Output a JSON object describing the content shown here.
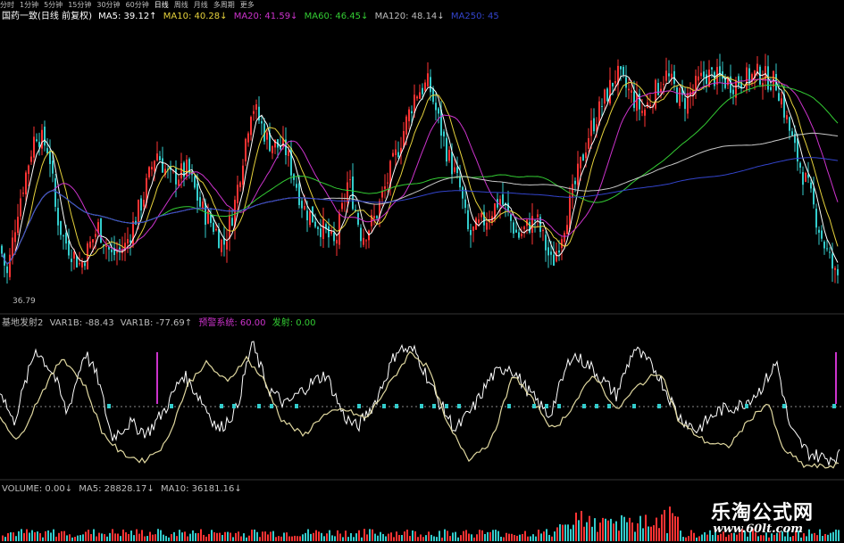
{
  "toolbar": {
    "items": [
      "分时",
      "1分钟",
      "5分钟",
      "15分钟",
      "30分钟",
      "60分钟",
      "日线",
      "周线",
      "月线",
      "多周期",
      "更多"
    ],
    "active_index": 6
  },
  "main_header": {
    "stock": "国药一致(日线 前复权)",
    "indicators": [
      {
        "text": "MA5: 39.12↑",
        "color": "#ffffff"
      },
      {
        "text": "MA10: 40.28↓",
        "color": "#e6d23c"
      },
      {
        "text": "MA20: 41.59↓",
        "color": "#cc33cc"
      },
      {
        "text": "MA60: 46.45↓",
        "color": "#33cc33"
      },
      {
        "text": "MA120: 48.14↓",
        "color": "#bdbdbd"
      },
      {
        "text": "MA250: 45",
        "color": "#3344cc"
      }
    ]
  },
  "low_label": "36.79",
  "osc_header": {
    "name": "基地发射2",
    "values": [
      {
        "text": "VAR1B: -88.43",
        "color": "#bdbdbd"
      },
      {
        "text": "VAR1B: -77.69↑",
        "color": "#bdbdbd"
      },
      {
        "text": "预警系统: 60.00",
        "color": "#cc33cc"
      },
      {
        "text": "发射: 0.00",
        "color": "#33cc33"
      }
    ]
  },
  "vol_header": {
    "values": [
      {
        "text": "VOLUME: 0.00↓",
        "color": "#bdbdbd"
      },
      {
        "text": "MA5: 28828.17↓",
        "color": "#bdbdbd"
      },
      {
        "text": "MA10: 36181.16↓",
        "color": "#bdbdbd"
      }
    ]
  },
  "watermark": {
    "title": "乐淘公式网",
    "url": "www.60lt.com"
  },
  "colors": {
    "up": "#ff3333",
    "down": "#33cccc",
    "ma5": "#ffffff",
    "ma10": "#e6d23c",
    "ma20": "#cc33cc",
    "ma60": "#33cc33",
    "ma120": "#c8c8c8",
    "ma250": "#3344cc",
    "var1": "#ffffff",
    "var2": "#e0d8a0",
    "signal": "#33cccc"
  },
  "chart_data": {
    "type": "candlestick",
    "title": "国药一致(日线 前复权)",
    "price_range": [
      35,
      62
    ],
    "lowest_marked": 36.79,
    "price_path": [
      [
        0,
        40
      ],
      [
        8,
        37
      ],
      [
        20,
        44
      ],
      [
        40,
        52
      ],
      [
        55,
        50
      ],
      [
        62,
        44
      ],
      [
        70,
        41
      ],
      [
        90,
        38
      ],
      [
        110,
        42
      ],
      [
        125,
        39
      ],
      [
        140,
        40
      ],
      [
        160,
        45
      ],
      [
        175,
        50
      ],
      [
        190,
        47
      ],
      [
        210,
        48
      ],
      [
        225,
        44
      ],
      [
        240,
        42
      ],
      [
        250,
        40
      ],
      [
        262,
        44
      ],
      [
        282,
        55
      ],
      [
        300,
        51
      ],
      [
        320,
        50
      ],
      [
        340,
        44
      ],
      [
        360,
        42
      ],
      [
        375,
        40
      ],
      [
        390,
        47
      ],
      [
        405,
        41
      ],
      [
        420,
        43
      ],
      [
        445,
        50
      ],
      [
        465,
        56
      ],
      [
        480,
        57
      ],
      [
        500,
        50
      ],
      [
        515,
        46
      ],
      [
        525,
        41
      ],
      [
        545,
        43
      ],
      [
        560,
        45
      ],
      [
        580,
        41
      ],
      [
        600,
        43
      ],
      [
        618,
        38
      ],
      [
        640,
        45
      ],
      [
        660,
        52
      ],
      [
        690,
        58
      ],
      [
        720,
        54
      ],
      [
        745,
        58
      ],
      [
        765,
        55
      ],
      [
        790,
        58
      ],
      [
        820,
        57
      ],
      [
        850,
        58
      ],
      [
        870,
        57
      ],
      [
        890,
        50
      ],
      [
        905,
        46
      ],
      [
        920,
        41
      ],
      [
        935,
        37
      ]
    ],
    "oscillator": {
      "series": [
        {
          "name": "VAR1B",
          "points": [
            [
              0,
              60
            ],
            [
              15,
              35
            ],
            [
              40,
              88
            ],
            [
              60,
              70
            ],
            [
              75,
              42
            ],
            [
              95,
              86
            ],
            [
              110,
              66
            ],
            [
              125,
              25
            ],
            [
              145,
              35
            ],
            [
              165,
              28
            ],
            [
              185,
              45
            ],
            [
              205,
              70
            ],
            [
              225,
              52
            ],
            [
              245,
              30
            ],
            [
              265,
              45
            ],
            [
              282,
              92
            ],
            [
              300,
              60
            ],
            [
              320,
              48
            ],
            [
              345,
              62
            ],
            [
              365,
              70
            ],
            [
              385,
              40
            ],
            [
              400,
              32
            ],
            [
              420,
              50
            ],
            [
              445,
              88
            ],
            [
              465,
              86
            ],
            [
              490,
              52
            ],
            [
              510,
              30
            ],
            [
              530,
              46
            ],
            [
              550,
              68
            ],
            [
              570,
              76
            ],
            [
              595,
              55
            ],
            [
              615,
              40
            ],
            [
              640,
              84
            ],
            [
              660,
              76
            ],
            [
              690,
              55
            ],
            [
              710,
              88
            ],
            [
              735,
              72
            ],
            [
              760,
              40
            ],
            [
              780,
              30
            ],
            [
              805,
              44
            ],
            [
              830,
              48
            ],
            [
              850,
              58
            ],
            [
              870,
              78
            ],
            [
              885,
              30
            ],
            [
              905,
              14
            ],
            [
              925,
              10
            ],
            [
              940,
              12
            ]
          ]
        },
        {
          "name": "VAR1B",
          "points": [
            [
              0,
              40
            ],
            [
              20,
              22
            ],
            [
              45,
              55
            ],
            [
              70,
              82
            ],
            [
              95,
              62
            ],
            [
              115,
              28
            ],
            [
              135,
              14
            ],
            [
              160,
              8
            ],
            [
              185,
              20
            ],
            [
              210,
              62
            ],
            [
              230,
              78
            ],
            [
              255,
              64
            ],
            [
              275,
              82
            ],
            [
              295,
              66
            ],
            [
              315,
              38
            ],
            [
              340,
              26
            ],
            [
              360,
              40
            ],
            [
              385,
              45
            ],
            [
              410,
              38
            ],
            [
              435,
              62
            ],
            [
              460,
              86
            ],
            [
              480,
              74
            ],
            [
              500,
              35
            ],
            [
              525,
              10
            ],
            [
              550,
              22
            ],
            [
              575,
              70
            ],
            [
              600,
              48
            ],
            [
              620,
              30
            ],
            [
              640,
              46
            ],
            [
              665,
              70
            ],
            [
              690,
              44
            ],
            [
              715,
              62
            ],
            [
              740,
              72
            ],
            [
              760,
              36
            ],
            [
              790,
              22
            ],
            [
              815,
              18
            ],
            [
              840,
              38
            ],
            [
              860,
              50
            ],
            [
              875,
              18
            ],
            [
              900,
              5
            ],
            [
              925,
              4
            ],
            [
              940,
              6
            ]
          ]
        }
      ],
      "warning_level": 60,
      "fire_level": 0
    }
  }
}
